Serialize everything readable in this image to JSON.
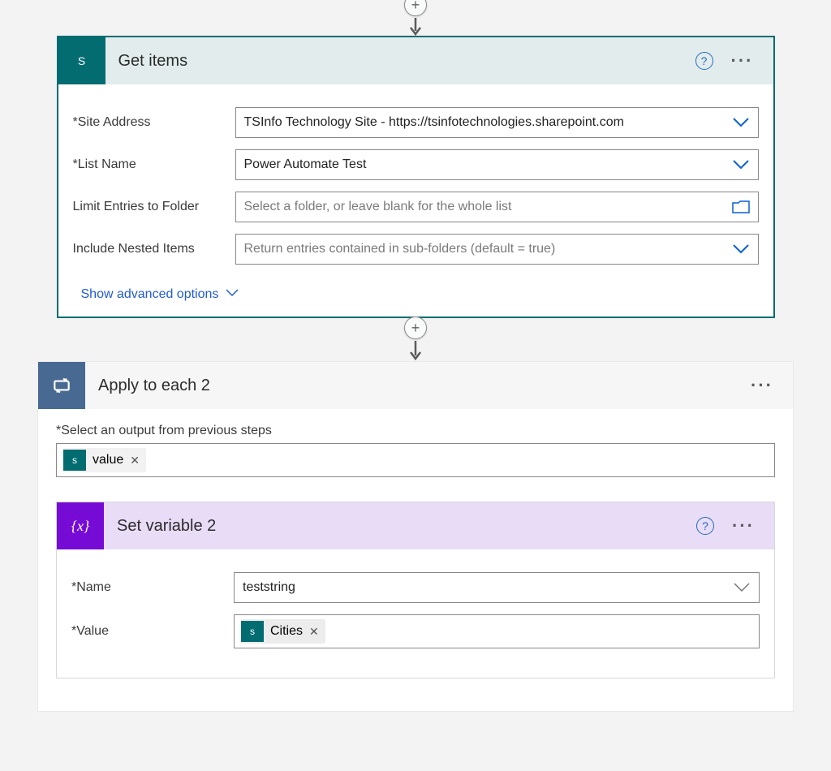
{
  "connector": {
    "plus": "+"
  },
  "getItems": {
    "title": "Get items",
    "help": "?",
    "menu": "···",
    "fields": {
      "siteAddress": {
        "label": "*Site Address",
        "value": "TSInfo Technology Site - https://tsinfotechnologies.sharepoint.com"
      },
      "listName": {
        "label": "*List Name",
        "value": "Power Automate Test"
      },
      "limitEntries": {
        "label": "Limit Entries to Folder",
        "placeholder": "Select a folder, or leave blank for the whole list"
      },
      "includeNested": {
        "label": "Include Nested Items",
        "placeholder": "Return entries contained in sub-folders (default = true)"
      }
    },
    "advanced": "Show advanced options"
  },
  "applyEach": {
    "title": "Apply to each 2",
    "menu": "···",
    "selectLabel": "*Select an output from previous steps",
    "token": {
      "label": "value",
      "remove": "✕"
    }
  },
  "setVar": {
    "title": "Set variable 2",
    "help": "?",
    "menu": "···",
    "name": {
      "label": "*Name",
      "value": "teststring"
    },
    "value": {
      "label": "*Value",
      "token": "Cities",
      "remove": "✕"
    }
  },
  "iconText": {
    "sp": "S",
    "var": "{x}"
  }
}
